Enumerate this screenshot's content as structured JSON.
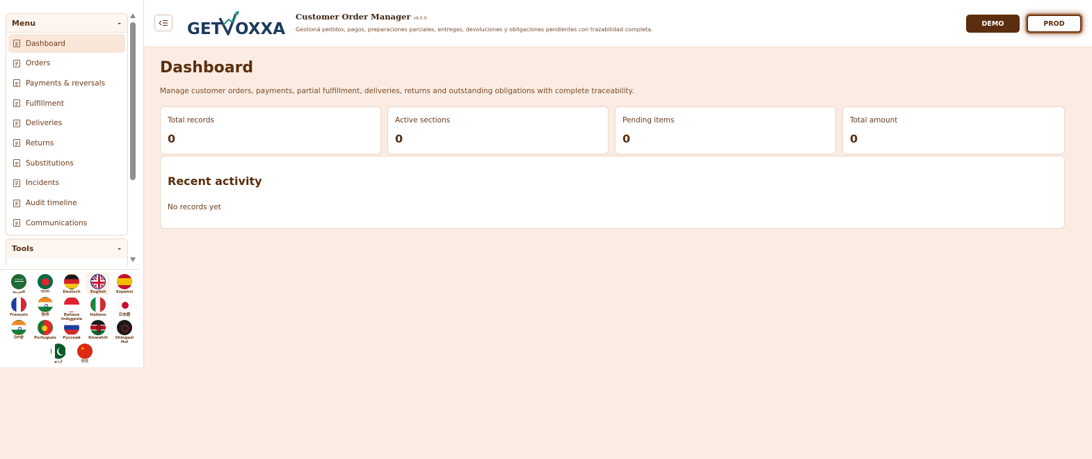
{
  "sidebar": {
    "menu": {
      "title": "Menu",
      "collapse_symbol": "-",
      "items": [
        {
          "label": "Dashboard",
          "active": true
        },
        {
          "label": "Orders"
        },
        {
          "label": "Payments & reversals"
        },
        {
          "label": "Fulfillment"
        },
        {
          "label": "Deliveries"
        },
        {
          "label": "Returns"
        },
        {
          "label": "Substitutions"
        },
        {
          "label": "Incidents"
        },
        {
          "label": "Audit timeline"
        },
        {
          "label": "Communications"
        }
      ]
    },
    "tools": {
      "title": "Tools",
      "collapse_symbol": "-"
    },
    "languages": [
      {
        "label": "العربية",
        "flag": "arabic"
      },
      {
        "label": "বাংলা",
        "flag": "bangladesh"
      },
      {
        "label": "Deutsch",
        "flag": "germany"
      },
      {
        "label": "English",
        "flag": "uk",
        "selected": true
      },
      {
        "label": "Español",
        "flag": "spain"
      },
      {
        "label": "Français",
        "flag": "france"
      },
      {
        "label": "हिन्दी",
        "flag": "india"
      },
      {
        "label": "Bahasa Indonesia",
        "flag": "indonesia"
      },
      {
        "label": "Italiano",
        "flag": "italy"
      },
      {
        "label": "日本語",
        "flag": "japan"
      },
      {
        "label": "ਪੰਜਾਬੀ",
        "flag": "india"
      },
      {
        "label": "Português",
        "flag": "portugal"
      },
      {
        "label": "Русский",
        "flag": "russia"
      },
      {
        "label": "Kiswahili",
        "flag": "kenya"
      },
      {
        "label": "Shingazi Hul",
        "flag": "dark"
      },
      {
        "label": "اردو",
        "flag": "pakistan"
      },
      {
        "label": "中文",
        "flag": "china"
      }
    ]
  },
  "header": {
    "logo_text": {
      "left": "GET",
      "right": "OXXA"
    },
    "app_title": "Customer Order Manager",
    "app_version": "v9.0.0",
    "app_subtitle": "Gestioná pedidos, pagos, preparaciones parciales, entregas, devoluciones y obligaciones pendientes con trazabilidad completa.",
    "env_demo": "DEMO",
    "env_prod": "PROD"
  },
  "main": {
    "title": "Dashboard",
    "description": "Manage customer orders, payments, partial fulfillment, deliveries, returns and outstanding obligations with complete traceability.",
    "stats": [
      {
        "label": "Total records",
        "value": "0"
      },
      {
        "label": "Active sections",
        "value": "0"
      },
      {
        "label": "Pending items",
        "value": "0"
      },
      {
        "label": "Total amount",
        "value": "0"
      }
    ],
    "activity": {
      "title": "Recent activity",
      "empty_text": "No records yet"
    }
  },
  "colors": {
    "background": "#faece2",
    "accent_dark": "#5a2e0e",
    "border": "#ecd7c6",
    "active_item": "#fae6d8"
  },
  "icons": {
    "menu_item": "document-icon",
    "toggle": "sidebar-collapse-icon"
  }
}
